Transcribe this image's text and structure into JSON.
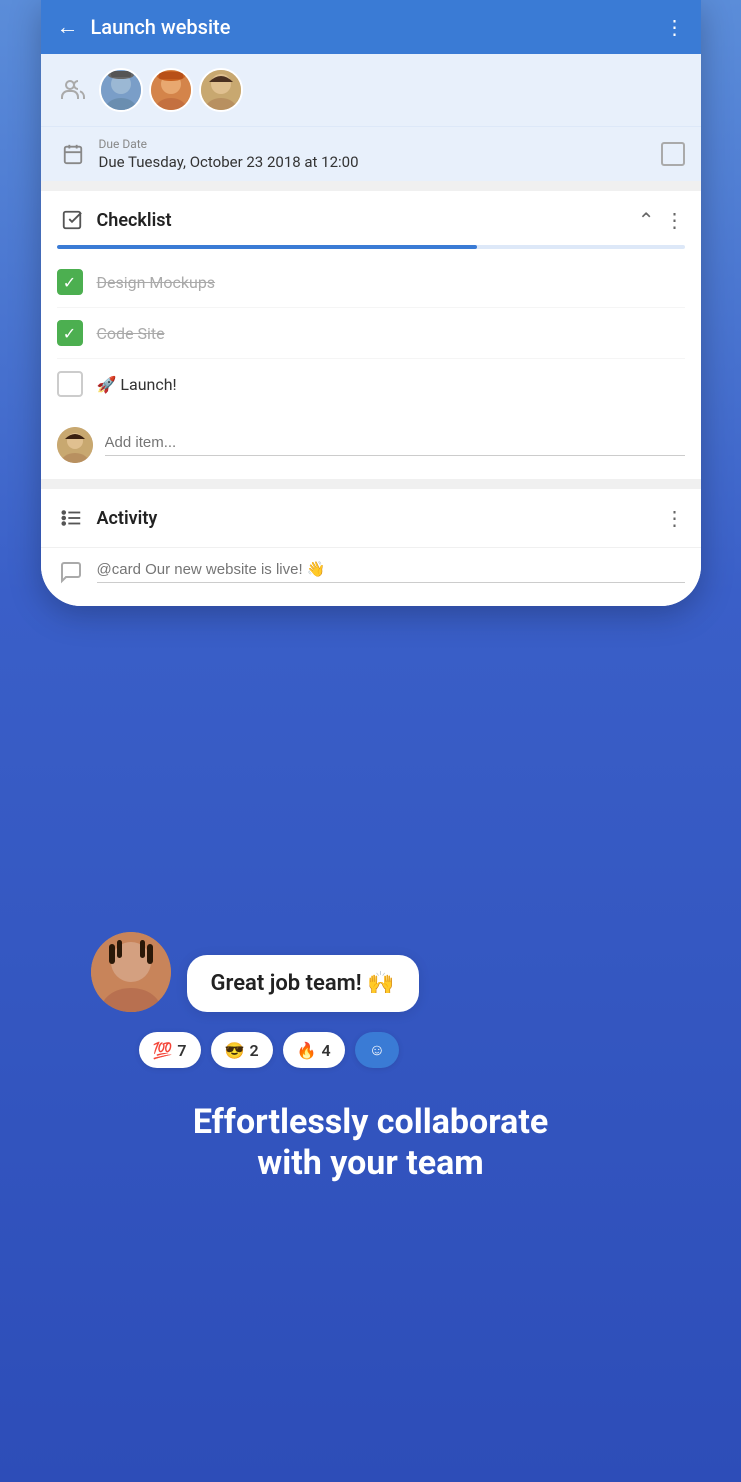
{
  "header": {
    "back_label": "←",
    "title": "Launch website",
    "more_label": "⋮"
  },
  "members": {
    "icon": "👤",
    "avatars": [
      "👦",
      "👨",
      "👩"
    ]
  },
  "due_date": {
    "label": "Due Date",
    "value": "Due Tuesday, October 23 2018 at 12:00",
    "calendar_icon": "📅"
  },
  "checklist": {
    "title": "Checklist",
    "progress_percent": 67,
    "items": [
      {
        "text": "Design Mockups",
        "checked": true,
        "strikethrough": true
      },
      {
        "text": "Code Site",
        "checked": true,
        "strikethrough": true
      },
      {
        "text": "🚀 Launch!",
        "checked": false,
        "strikethrough": false
      }
    ],
    "add_item_placeholder": "Add item..."
  },
  "activity": {
    "title": "Activity",
    "comment_placeholder": "@card Our new website is live! 👋"
  },
  "chat": {
    "message": "Great job team! 🙌",
    "reactions": [
      {
        "emoji": "💯",
        "count": "7"
      },
      {
        "emoji": "😎",
        "count": "2"
      },
      {
        "emoji": "🔥",
        "count": "4"
      }
    ],
    "add_reaction_icon": "☺"
  },
  "tagline": {
    "line1": "Effortlessly collaborate",
    "line2": "with your team"
  }
}
